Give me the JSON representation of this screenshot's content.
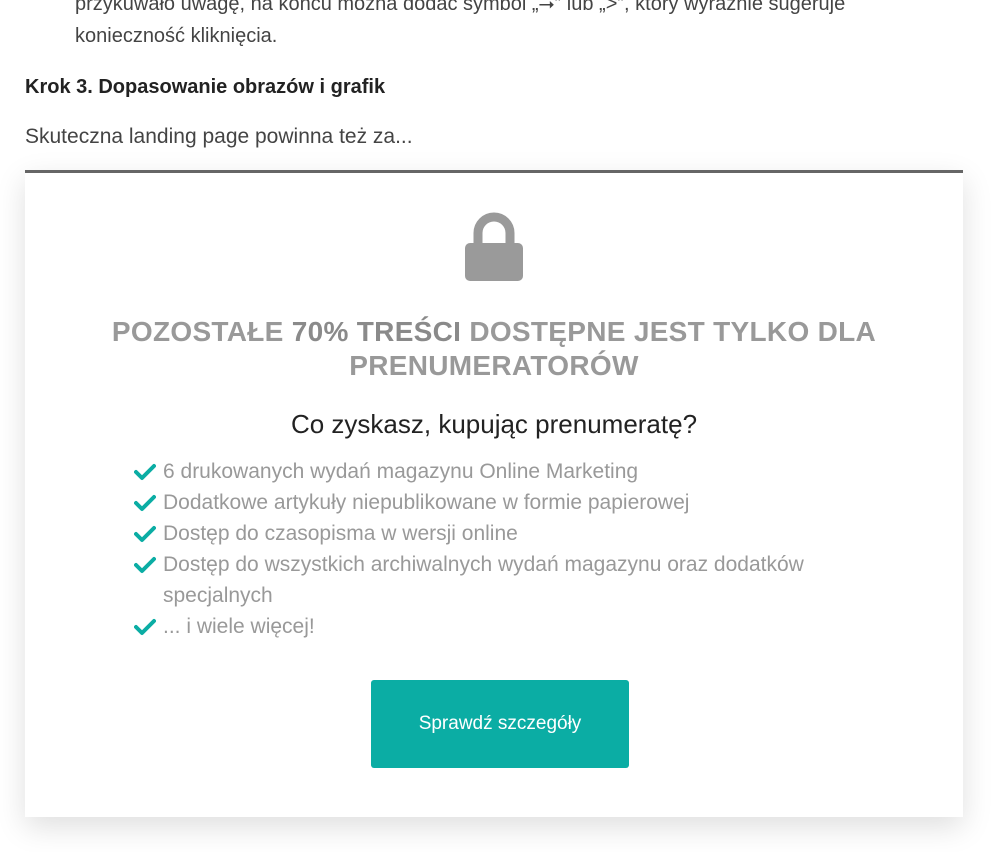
{
  "article": {
    "prev_paragraph": "przykuwało uwagę, na końcu można dodać symbol „⭢” lub „>”, który wyraźnie sugeruje konieczność kliknięcia.",
    "step_heading": "Krok 3. Dopasowanie obrazów i grafik",
    "teaser": "Skuteczna landing page powinna też za..."
  },
  "paywall": {
    "lock_icon": "lock-icon",
    "title_part1": "POZOSTAŁE ",
    "title_highlight": "70% TREŚCI",
    "title_part2": " DOSTĘPNE JEST TYLKO DLA PRENUMERATORÓW",
    "benefits_heading": "Co zyskasz, kupując prenumeratę?",
    "benefits": [
      "6 drukowanych wydań magazynu Online Marketing",
      "Dodatkowe artykuły niepublikowane w formie papierowej",
      "Dostęp do czasopisma w wersji online",
      "Dostęp do wszystkich archiwalnych wydań magazynu oraz dodatków specjalnych",
      "... i wiele więcej!"
    ],
    "check_icon": "check-icon",
    "cta_label": "Sprawdź szczegóły",
    "colors": {
      "accent": "#0bada4",
      "muted_text": "#999999",
      "top_border": "#666666"
    }
  }
}
